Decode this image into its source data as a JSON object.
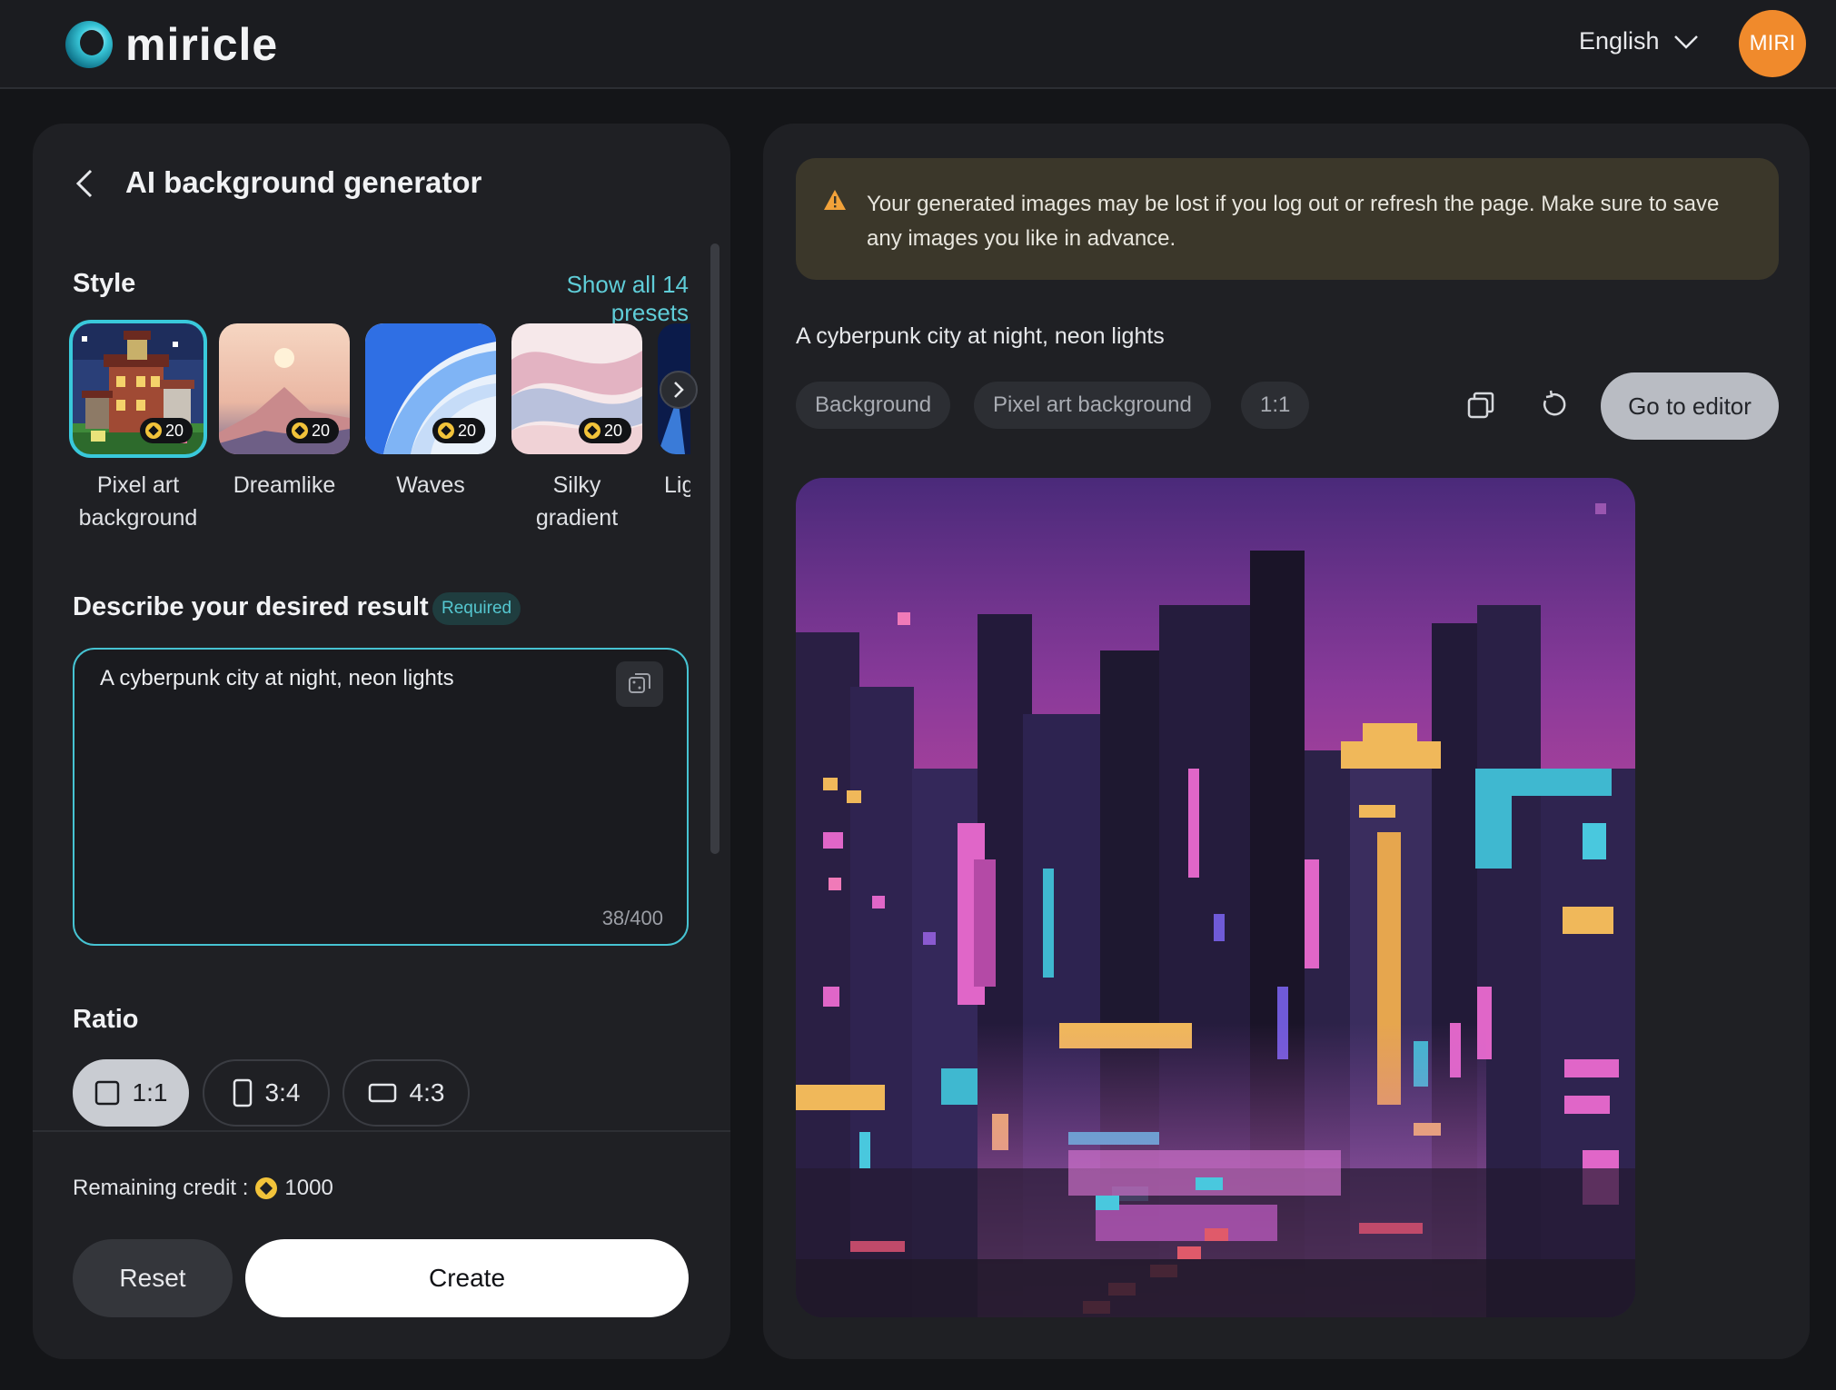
{
  "header": {
    "brand": "miricle",
    "language": "English",
    "avatar": "MIRI"
  },
  "left": {
    "title": "AI background generator",
    "style_label": "Style",
    "show_all": "Show all 14 presets",
    "presets": [
      {
        "label_1": "Pixel art",
        "label_2": "background",
        "credits": "20",
        "selected": true
      },
      {
        "label_1": "Dreamlike",
        "label_2": "",
        "credits": "20",
        "selected": false
      },
      {
        "label_1": "Waves",
        "label_2": "",
        "credits": "20",
        "selected": false
      },
      {
        "label_1": "Silky",
        "label_2": "gradient",
        "credits": "20",
        "selected": false
      },
      {
        "label_1": "Lig",
        "label_2": "",
        "credits": "",
        "selected": false
      }
    ],
    "describe_label": "Describe your desired result",
    "required": "Required",
    "prompt": "A cyberpunk city at night, neon lights",
    "counter_current": "38",
    "counter_max": "/400",
    "ratio_label": "Ratio",
    "ratios": [
      "1:1",
      "3:4",
      "4:3"
    ],
    "ratio_selected": "1:1",
    "remaining_label": "Remaining credit :",
    "remaining_value": "1000",
    "reset": "Reset",
    "create": "Create"
  },
  "right": {
    "warning": "Your generated images may be lost if you log out or refresh the page. Make sure to save any images you like in advance.",
    "prompt": "A cyberpunk city at night, neon lights",
    "tags": [
      "Background",
      "Pixel art background",
      "1:1"
    ],
    "go_to_editor": "Go to editor"
  },
  "colors": {
    "accent": "#39c9db",
    "avatar": "#f08a2c",
    "coin": "#f2c33a"
  },
  "icons": [
    "back-chevron-icon",
    "chevron-down-icon",
    "chevron-right-icon",
    "dice-icon",
    "warning-icon",
    "copy-icon",
    "regenerate-icon",
    "coin-icon",
    "square-ratio-icon",
    "portrait-ratio-icon",
    "landscape-ratio-icon"
  ]
}
